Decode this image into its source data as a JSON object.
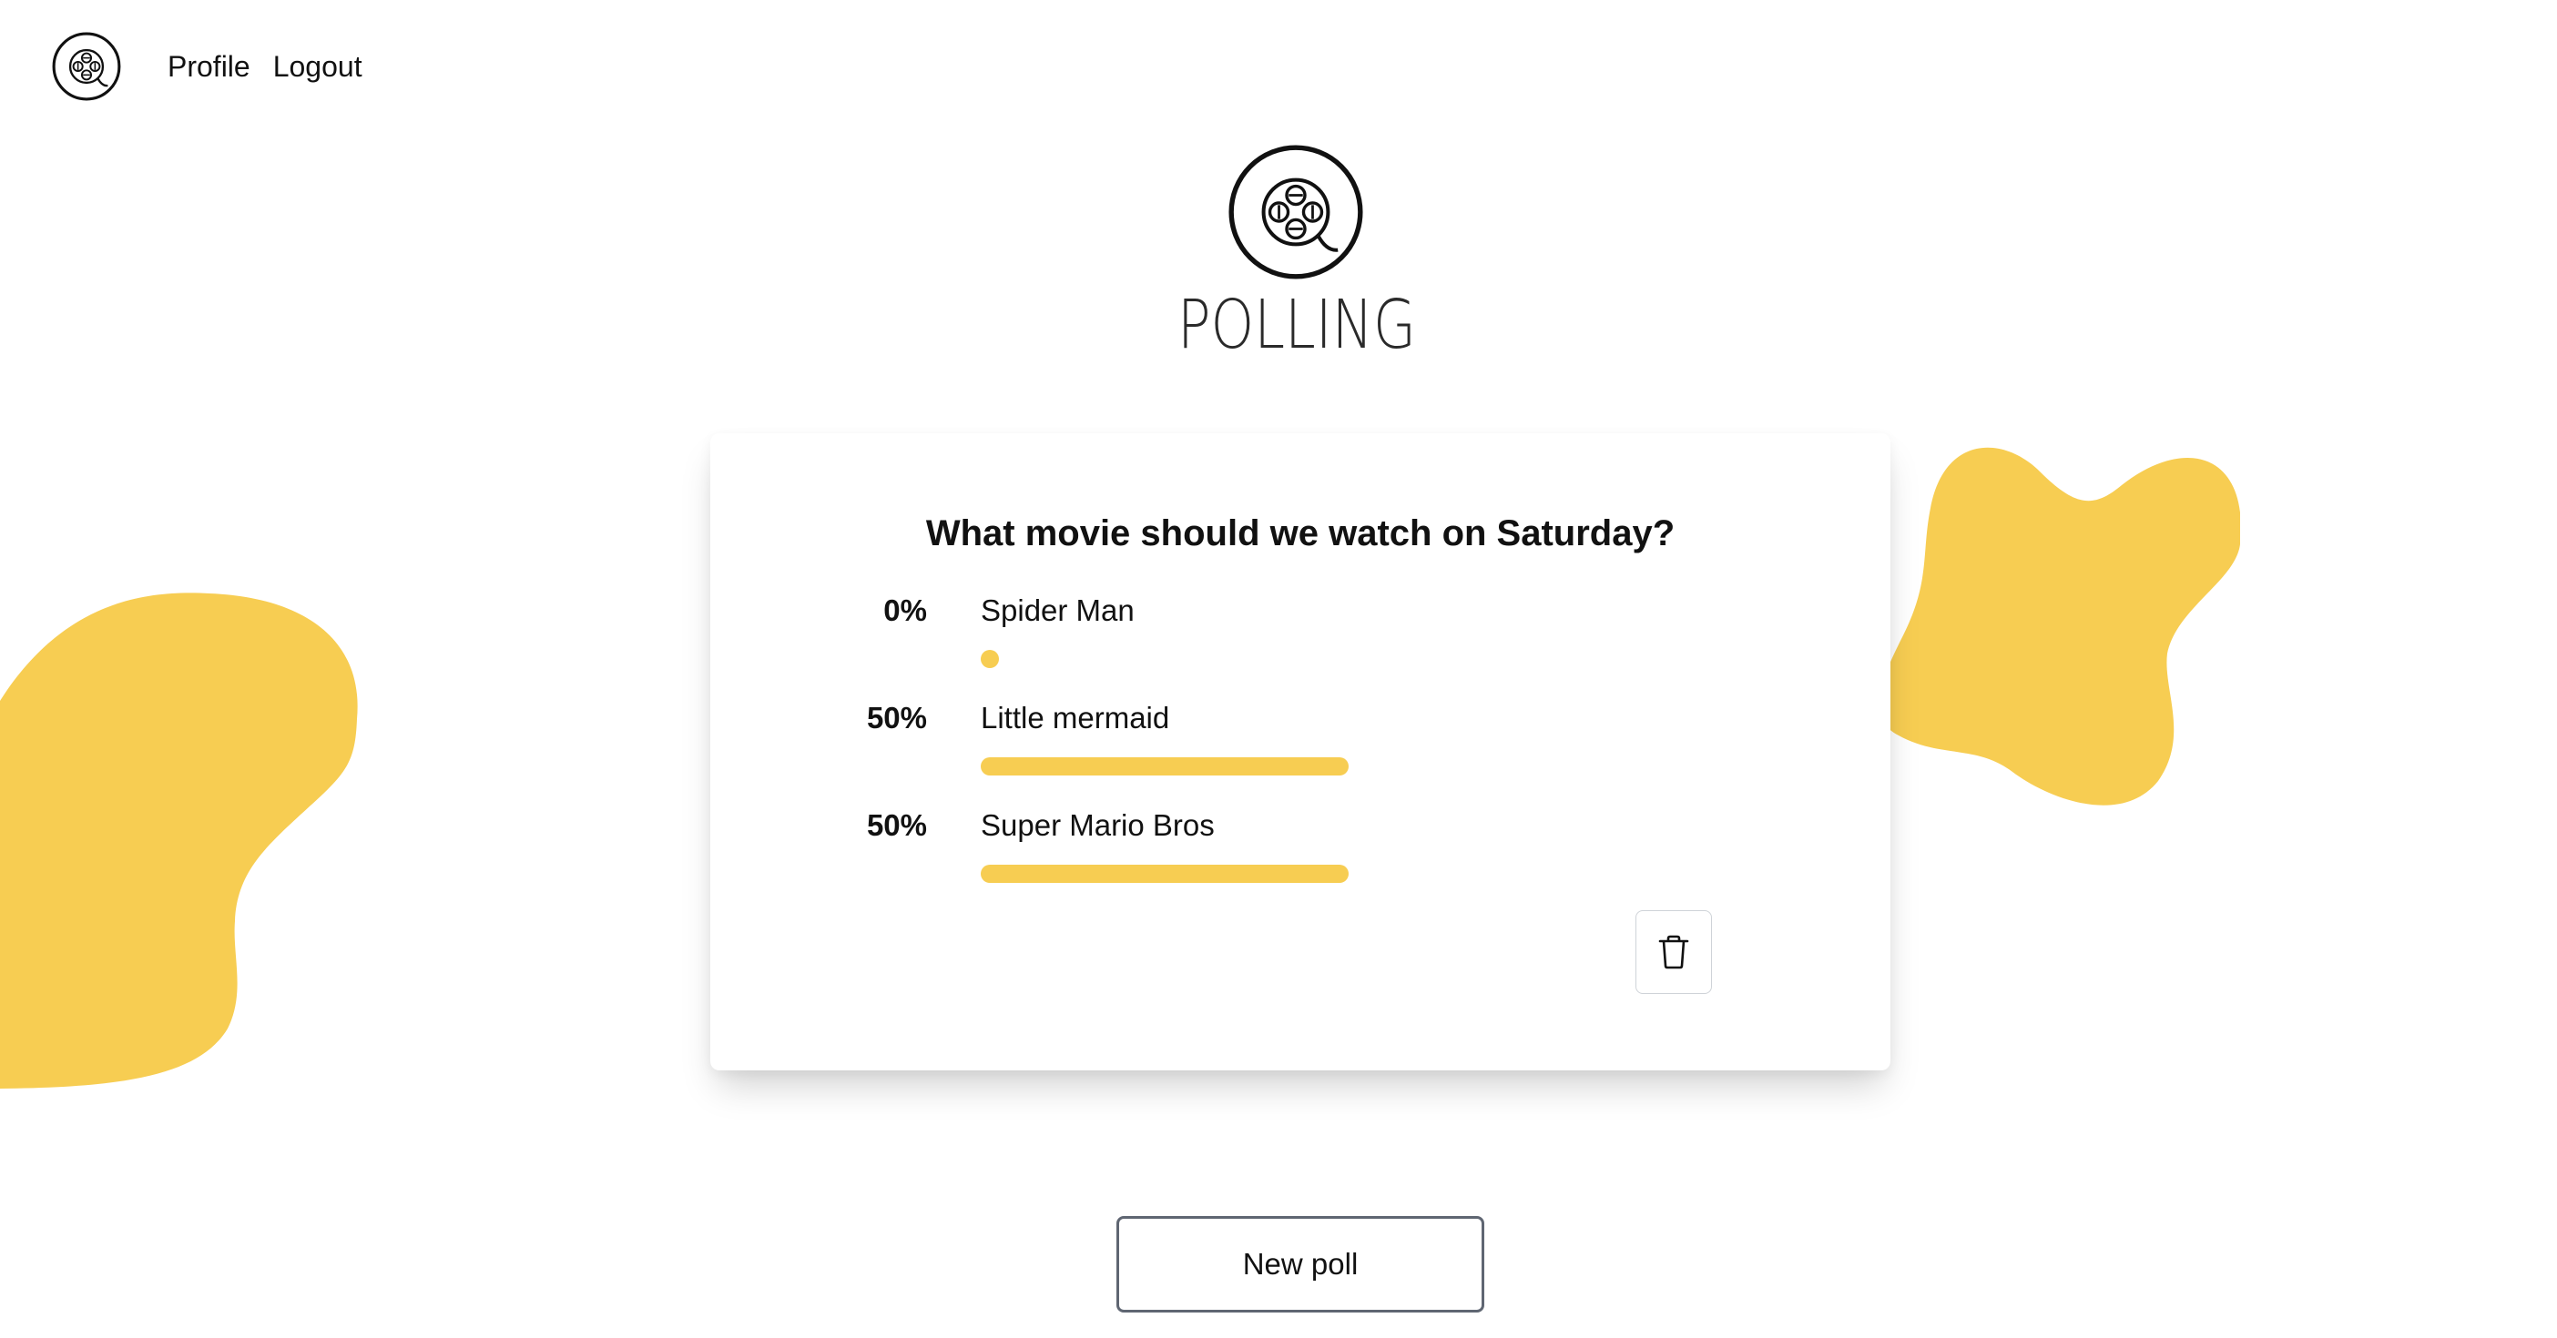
{
  "nav": {
    "logo_icon": "film-reel-logo-icon",
    "profile_label": "Profile",
    "logout_label": "Logout"
  },
  "brand": {
    "logo_icon": "film-reel-logo-icon",
    "wordmark": "POLLING"
  },
  "poll": {
    "question": "What movie should we watch on Saturday?",
    "options": [
      {
        "percent_label": "0%",
        "label": "Spider Man",
        "fraction": 0
      },
      {
        "percent_label": "50%",
        "label": "Little mermaid",
        "fraction": 0.5
      },
      {
        "percent_label": "50%",
        "label": "Super Mario Bros",
        "fraction": 0.5
      }
    ],
    "delete_icon": "trash-icon"
  },
  "new_poll_label": "New poll",
  "colors": {
    "accent": "#f7cd52",
    "text": "#111111",
    "button_border": "#5f6672"
  }
}
